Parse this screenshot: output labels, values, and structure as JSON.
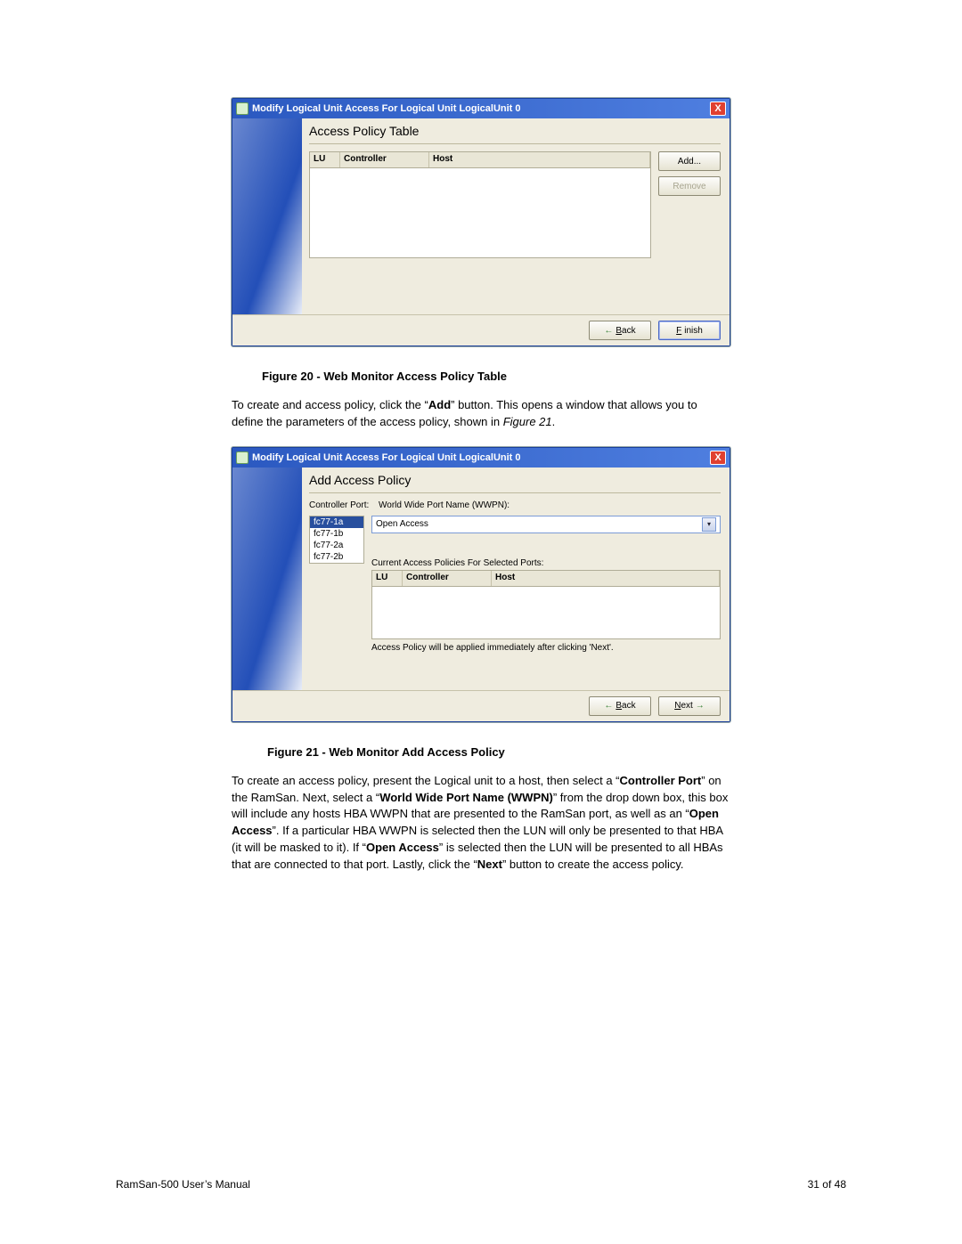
{
  "dialog1": {
    "title": "Modify Logical Unit Access For Logical Unit LogicalUnit 0",
    "heading": "Access Policy Table",
    "cols": {
      "lu": "LU",
      "controller": "Controller",
      "host": "Host"
    },
    "buttons": {
      "add": "Add...",
      "remove": "Remove"
    },
    "footer": {
      "back": "Back",
      "finish": "Finish"
    }
  },
  "figcap1": "Figure 20 - Web Monitor Access Policy Table",
  "para1_pre": "To create and access policy, click the “",
  "para1_bold1": "Add",
  "para1_mid": "” button.  This opens a window that allows you to define the parameters of the access policy, shown in ",
  "para1_it": "Figure 21",
  "para1_post": ".",
  "dialog2": {
    "title": "Modify Logical Unit Access For Logical Unit LogicalUnit 0",
    "heading": "Add Access Policy",
    "label_port": "Controller Port:",
    "label_wwpn": "World Wide Port Name (WWPN):",
    "combo_value": "Open Access",
    "ports": [
      "fc77-1a",
      "fc77-1b",
      "fc77-2a",
      "fc77-2b"
    ],
    "cap_label": "Current Access Policies For Selected Ports:",
    "cols": {
      "lu": "LU",
      "controller": "Controller",
      "host": "Host"
    },
    "applynote": "Access Policy will be applied immediately after clicking 'Next'.",
    "footer": {
      "back": "Back",
      "next": "Next"
    }
  },
  "figcap2": "Figure 21 - Web Monitor Add Access Policy",
  "para2": {
    "t1": "To create an access policy, present the Logical unit to a host, then select a “",
    "b1": "Controller Port",
    "t2": "” on the RamSan.  Next, select a “",
    "b2": "World Wide Port Name (WWPN)",
    "t3": "” from the drop down box, this box will include any hosts HBA WWPN that are presented to the RamSan port, as well as an “",
    "b3": "Open Access",
    "t4": "”. If a particular HBA WWPN is selected then the LUN will only be presented to that HBA (it will be masked to it).  If “",
    "b4": "Open Access",
    "t5": "” is selected then the LUN will be presented to all HBAs that are connected to that port.  Lastly, click the “",
    "b5": "Next",
    "t6": "” button to create the access policy."
  },
  "footer": {
    "left": "RamSan-500 User’s Manual",
    "right": "31 of 48"
  }
}
